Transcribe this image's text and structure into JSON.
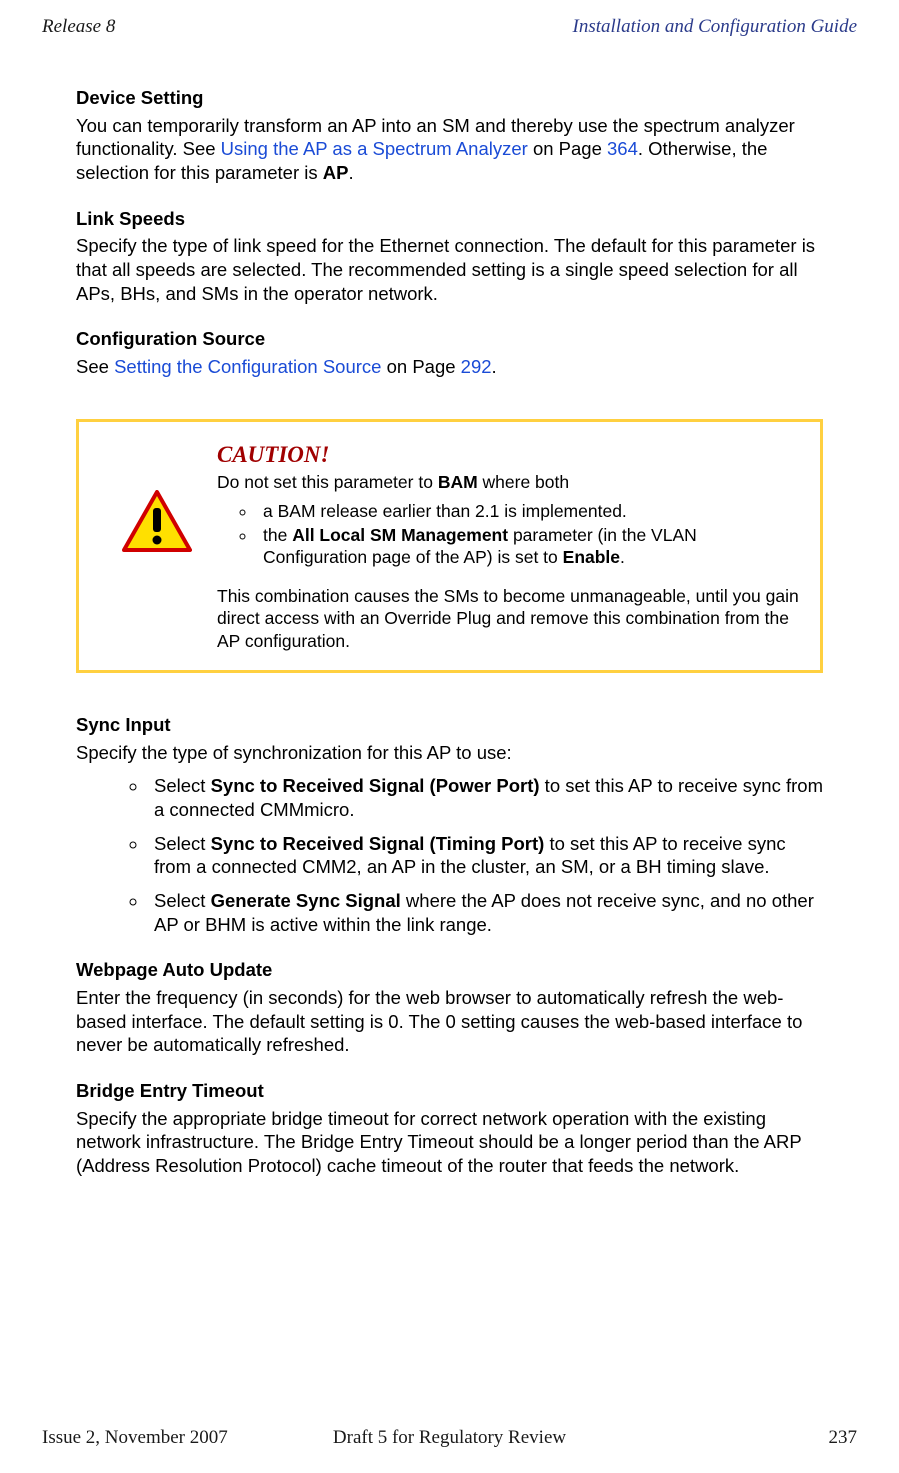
{
  "header": {
    "left": "Release 8",
    "right": "Installation and Configuration Guide"
  },
  "s1": {
    "heading": "Device Setting",
    "p1a": "You can temporarily transform an AP into an SM and thereby use the spectrum analyzer functionality. See ",
    "link1": "Using the AP as a Spectrum Analyzer",
    "p1b": " on Page ",
    "page1": "364",
    "p1c": ". Otherwise, the selection for this parameter is ",
    "bold1": "AP",
    "p1d": "."
  },
  "s2": {
    "heading": "Link Speeds",
    "p": "Specify the type of link speed for the Ethernet connection. The default for this parameter is that all speeds are selected. The recommended setting is a single speed selection for all APs, BHs, and SMs in the operator network."
  },
  "s3": {
    "heading": "Configuration Source",
    "p1a": "See ",
    "link1": "Setting the Configuration Source",
    "p1b": " on Page ",
    "page1": "292",
    "p1c": "."
  },
  "caution": {
    "title": "CAUTION!",
    "p1a": "Do not set this parameter to ",
    "bold1": "BAM",
    "p1b": " where both",
    "li1": "a BAM release earlier than 2.1 is implemented.",
    "li2a": "the ",
    "li2bold": "All Local SM Management",
    "li2b": " parameter (in the VLAN Configuration page of the AP) is set to ",
    "li2bold2": "Enable",
    "li2c": ".",
    "p2": "This combination causes the SMs to become unmanageable, until you gain direct access with an Override Plug and remove this combination from the AP configuration."
  },
  "s4": {
    "heading": "Sync Input",
    "intro": "Specify the type of synchronization for this AP to use:",
    "li1a": "Select ",
    "li1bold": "Sync to Received Signal (Power Port)",
    "li1b": " to set this AP to receive sync from a connected CMMmicro.",
    "li2a": "Select ",
    "li2bold": "Sync to Received Signal (Timing Port)",
    "li2b": " to set this AP to receive sync from a connected CMM2, an AP in the cluster, an SM, or a BH timing slave.",
    "li3a": "Select ",
    "li3bold": "Generate Sync Signal",
    "li3b": " where the AP does not receive sync, and no other AP or BHM is active within the link range."
  },
  "s5": {
    "heading": "Webpage Auto Update",
    "p": "Enter the frequency (in seconds) for the web browser to automatically refresh the web-based interface. The default setting is 0. The 0 setting causes the web-based interface to never be automatically refreshed."
  },
  "s6": {
    "heading": "Bridge Entry Timeout",
    "p": "Specify the appropriate bridge timeout for correct network operation with the existing network infrastructure. The Bridge Entry Timeout should be a longer period than the ARP (Address Resolution Protocol) cache timeout of the router that feeds the network."
  },
  "footer": {
    "left": "Issue 2, November 2007",
    "center": "Draft 5 for Regulatory Review",
    "right": "237"
  }
}
